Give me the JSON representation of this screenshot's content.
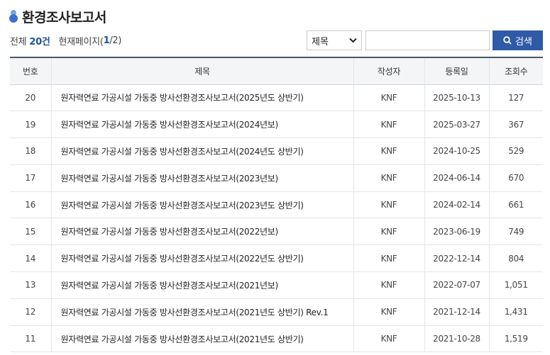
{
  "header": {
    "title": "환경조사보고서"
  },
  "summary": {
    "total_label": "전체",
    "total_count": "20건",
    "page_label": "현재페이지(",
    "current_page": "1",
    "page_tail": "/2)"
  },
  "search": {
    "field_selected": "제목",
    "query_value": "",
    "button_label": "검색"
  },
  "table": {
    "columns": [
      "번호",
      "제목",
      "작성자",
      "등록일",
      "조회수"
    ],
    "rows": [
      {
        "no": "20",
        "title": "원자력연료 가공시설 가동중 방사선환경조사보고서(2025년도 상반기)",
        "author": "KNF",
        "date": "2025-10-13",
        "views": "127"
      },
      {
        "no": "19",
        "title": "원자력연료 가공시설 가동중 방사선환경조사보고서(2024년보)",
        "author": "KNF",
        "date": "2025-03-27",
        "views": "367"
      },
      {
        "no": "18",
        "title": "원자력연료 가공시설 가동중 방사선환경조사보고서(2024년도 상반기)",
        "author": "KNF",
        "date": "2024-10-25",
        "views": "529"
      },
      {
        "no": "17",
        "title": "원자력연료 가공시설 가동중 방사선환경조사보고서(2023년보)",
        "author": "KNF",
        "date": "2024-06-14",
        "views": "670"
      },
      {
        "no": "16",
        "title": "원자력연료 가공시설 가동중 방사선환경조사보고서(2023년도 상반기)",
        "author": "KNF",
        "date": "2024-02-14",
        "views": "661"
      },
      {
        "no": "15",
        "title": "원자력연료 가공시설 가동중 방사선환경조사보고서(2022년보)",
        "author": "KNF",
        "date": "2023-06-19",
        "views": "749"
      },
      {
        "no": "14",
        "title": "원자력연료 가공시설 가동중 방사선환경조사보고서(2022년도 상반기)",
        "author": "KNF",
        "date": "2022-12-14",
        "views": "804"
      },
      {
        "no": "13",
        "title": "원자력연료 가공시설 가동중 방사선환경조사보고서(2021년보)",
        "author": "KNF",
        "date": "2022-07-07",
        "views": "1,051"
      },
      {
        "no": "12",
        "title": "원자력연료 가공시설 가동중 방사선환경조사보고서(2021년도 상반기) Rev.1",
        "author": "KNF",
        "date": "2021-12-14",
        "views": "1,431"
      },
      {
        "no": "11",
        "title": "원자력연료 가공시설 가동중 방사선환경조사보고서(2021년도 상반기)",
        "author": "KNF",
        "date": "2021-10-28",
        "views": "1,519"
      }
    ]
  },
  "icons": {
    "title_icon": "bullet-person-icon",
    "search_icon": "search-icon",
    "select_icon": "chevron-down-icon"
  },
  "colors": {
    "accent": "#2e5aa8",
    "highlight_text": "#1f4e9c",
    "header_bg": "#f4f5f7"
  }
}
